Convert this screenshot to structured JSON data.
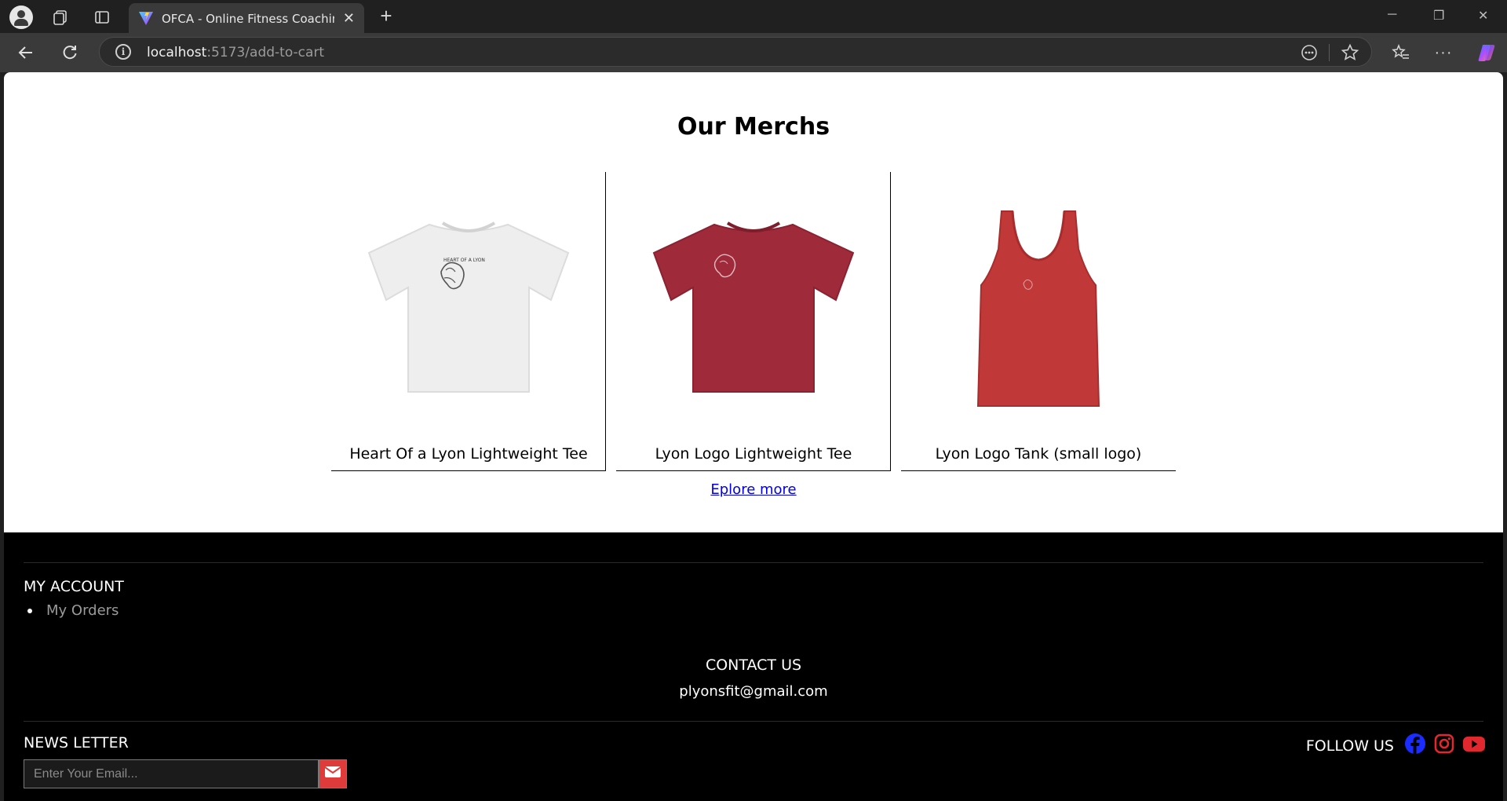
{
  "browser": {
    "tab_title": "OFCA - Online Fitness Coaching A",
    "url_host": "localhost",
    "url_path": ":5173/add-to-cart"
  },
  "page": {
    "title": "Our Merchs",
    "products": [
      {
        "name": "Heart Of a Lyon Lightweight Tee",
        "color": "#f0f0f0"
      },
      {
        "name": "Lyon Logo Lightweight Tee",
        "color": "#9e2a3a"
      },
      {
        "name": "Lyon Logo Tank (small logo)",
        "color": "#c03838"
      }
    ],
    "explore_label": "Eplore more"
  },
  "footer": {
    "account_title": "MY ACCOUNT",
    "account_items": [
      "My Orders"
    ],
    "contact_title": "CONTACT US",
    "contact_email": "plyonsfit@gmail.com",
    "newsletter_title": "NEWS LETTER",
    "newsletter_placeholder": "Enter Your Email...",
    "follow_label": "FOLLOW US",
    "social": [
      {
        "icon": "facebook-icon",
        "color": "#1a2cff"
      },
      {
        "icon": "instagram-icon",
        "color": "#e0282e"
      },
      {
        "icon": "youtube-icon",
        "color": "#e0282e"
      }
    ]
  }
}
